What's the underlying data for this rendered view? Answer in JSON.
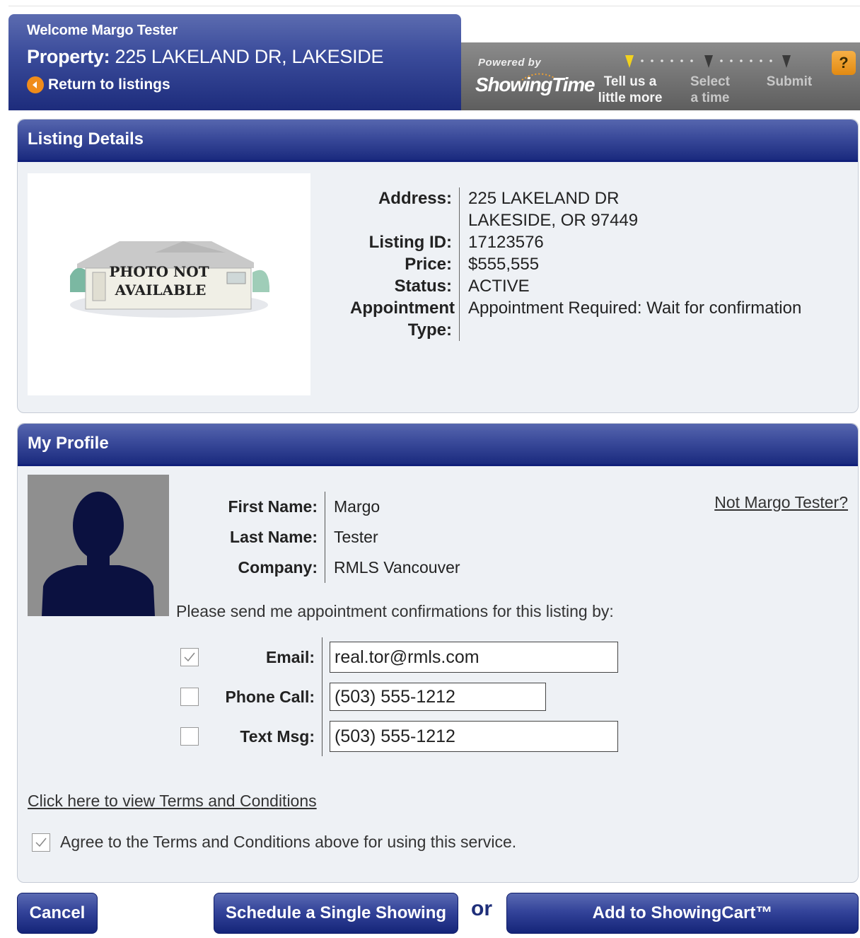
{
  "header": {
    "welcome": "Welcome Margo Tester",
    "property_label": "Property:",
    "property_value": "225 LAKELAND DR, LAKESIDE",
    "return_link": "Return to listings",
    "powered_by": "Powered by",
    "brand": "ShowingTime",
    "steps": [
      {
        "line1": "Tell us a",
        "line2": "little more"
      },
      {
        "line1": "Select",
        "line2": "a time"
      },
      {
        "line1": "Submit",
        "line2": ""
      }
    ],
    "help": "?"
  },
  "listing": {
    "title": "Listing Details",
    "photo_text_1": "PHOTO NOT",
    "photo_text_2": "AVAILABLE",
    "address_label": "Address:",
    "address_line1": "225 LAKELAND DR",
    "address_line2": "LAKESIDE, OR 97449",
    "listing_id_label": "Listing ID:",
    "listing_id": "17123576",
    "price_label": "Price:",
    "price": "$555,555",
    "status_label": "Status:",
    "status": "ACTIVE",
    "appt_label_1": "Appointment",
    "appt_label_2": "Type:",
    "appt_type": "Appointment Required: Wait for confirmation"
  },
  "profile": {
    "title": "My Profile",
    "first_name_label": "First Name:",
    "first_name": "Margo",
    "last_name_label": "Last Name:",
    "last_name": "Tester",
    "company_label": "Company:",
    "company": "RMLS Vancouver",
    "not_user_link": "Not Margo Tester?",
    "send_text": "Please send me appointment confirmations for this listing by:",
    "contacts": {
      "email_label": "Email:",
      "email_value": "real.tor@rmls.com",
      "email_checked": true,
      "phone_label": "Phone Call:",
      "phone_value": "(503) 555-1212",
      "phone_checked": false,
      "text_label": "Text Msg:",
      "text_value": "(503) 555-1212",
      "text_checked": false
    },
    "terms_link": "Click here to view Terms and Conditions",
    "agree_text": "Agree to the Terms and Conditions above for using this service.",
    "agree_checked": true
  },
  "actions": {
    "cancel": "Cancel",
    "single": "Schedule a Single Showing",
    "or": "or",
    "cart": "Add to ShowingCart™"
  },
  "colors": {
    "header_blue": "#1d2c7c",
    "accent_orange": "#f08c1a",
    "panel_bg": "#eef1f5",
    "header_grey": "#6e6e6e"
  }
}
